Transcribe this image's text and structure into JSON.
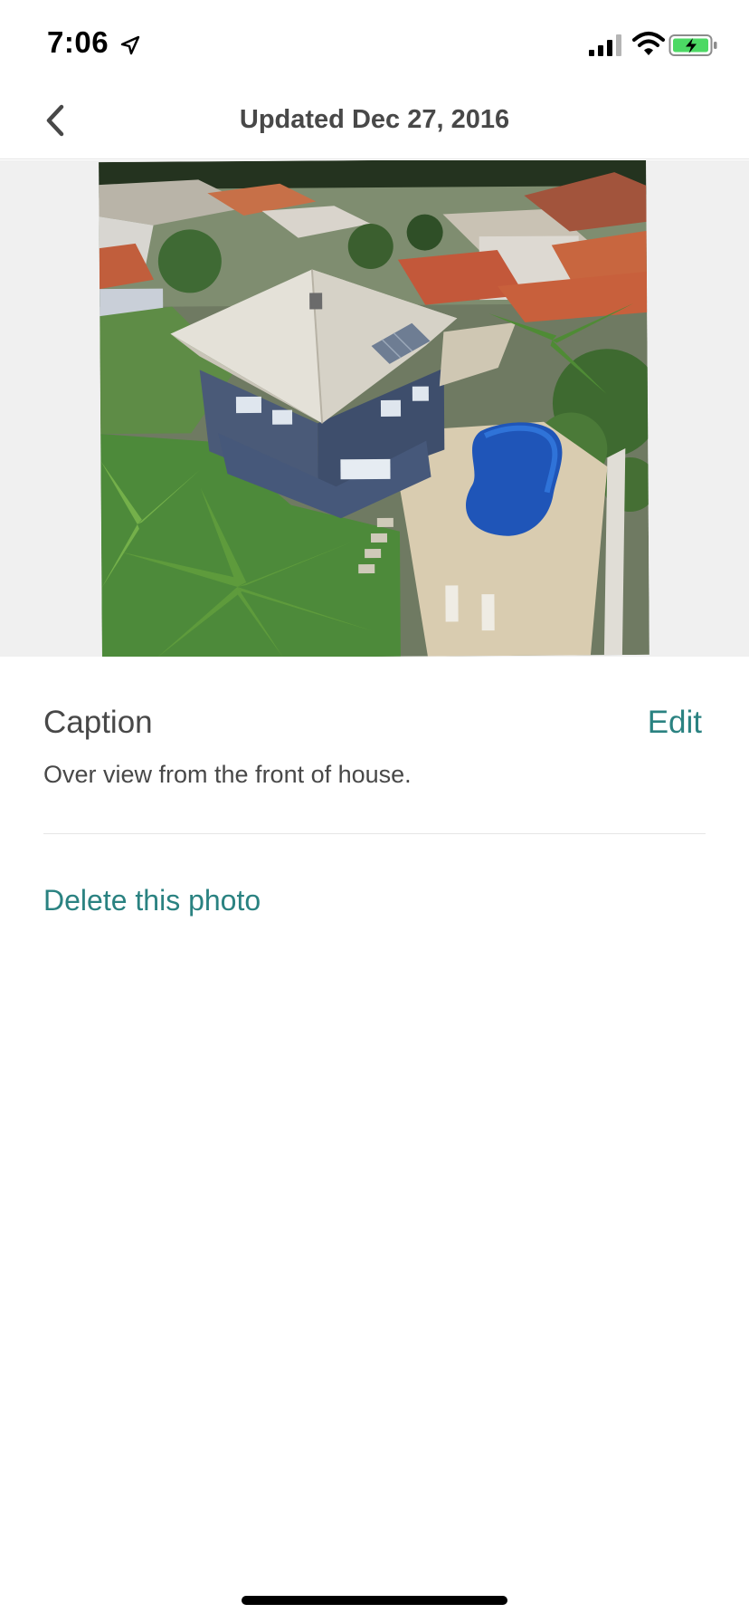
{
  "status_bar": {
    "time": "7:06",
    "icons": [
      "location-arrow-icon",
      "cellular-signal-icon",
      "wifi-icon",
      "battery-charging-icon"
    ]
  },
  "nav": {
    "title": "Updated Dec 27, 2016",
    "back_icon": "chevron-left-icon"
  },
  "photo": {
    "subject": "aerial-house-with-pool",
    "edit_icon": "pencil-icon"
  },
  "caption": {
    "label": "Caption",
    "edit_label": "Edit",
    "text": "Over view from the front of house."
  },
  "actions": {
    "delete_label": "Delete this photo"
  },
  "colors": {
    "accent": "#2a8281",
    "text": "#484848",
    "background": "#ffffff",
    "photo_bg": "#f0f0f0"
  }
}
